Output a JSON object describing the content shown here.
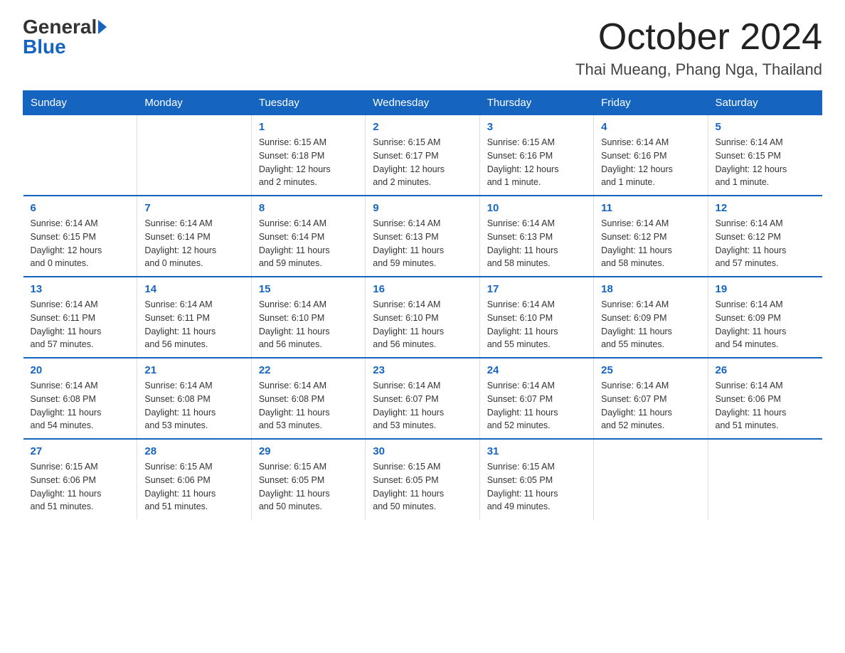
{
  "logo": {
    "general": "General",
    "blue": "Blue"
  },
  "header": {
    "month": "October 2024",
    "location": "Thai Mueang, Phang Nga, Thailand"
  },
  "weekdays": [
    "Sunday",
    "Monday",
    "Tuesday",
    "Wednesday",
    "Thursday",
    "Friday",
    "Saturday"
  ],
  "weeks": [
    [
      {
        "day": "",
        "info": ""
      },
      {
        "day": "",
        "info": ""
      },
      {
        "day": "1",
        "info": "Sunrise: 6:15 AM\nSunset: 6:18 PM\nDaylight: 12 hours\nand 2 minutes."
      },
      {
        "day": "2",
        "info": "Sunrise: 6:15 AM\nSunset: 6:17 PM\nDaylight: 12 hours\nand 2 minutes."
      },
      {
        "day": "3",
        "info": "Sunrise: 6:15 AM\nSunset: 6:16 PM\nDaylight: 12 hours\nand 1 minute."
      },
      {
        "day": "4",
        "info": "Sunrise: 6:14 AM\nSunset: 6:16 PM\nDaylight: 12 hours\nand 1 minute."
      },
      {
        "day": "5",
        "info": "Sunrise: 6:14 AM\nSunset: 6:15 PM\nDaylight: 12 hours\nand 1 minute."
      }
    ],
    [
      {
        "day": "6",
        "info": "Sunrise: 6:14 AM\nSunset: 6:15 PM\nDaylight: 12 hours\nand 0 minutes."
      },
      {
        "day": "7",
        "info": "Sunrise: 6:14 AM\nSunset: 6:14 PM\nDaylight: 12 hours\nand 0 minutes."
      },
      {
        "day": "8",
        "info": "Sunrise: 6:14 AM\nSunset: 6:14 PM\nDaylight: 11 hours\nand 59 minutes."
      },
      {
        "day": "9",
        "info": "Sunrise: 6:14 AM\nSunset: 6:13 PM\nDaylight: 11 hours\nand 59 minutes."
      },
      {
        "day": "10",
        "info": "Sunrise: 6:14 AM\nSunset: 6:13 PM\nDaylight: 11 hours\nand 58 minutes."
      },
      {
        "day": "11",
        "info": "Sunrise: 6:14 AM\nSunset: 6:12 PM\nDaylight: 11 hours\nand 58 minutes."
      },
      {
        "day": "12",
        "info": "Sunrise: 6:14 AM\nSunset: 6:12 PM\nDaylight: 11 hours\nand 57 minutes."
      }
    ],
    [
      {
        "day": "13",
        "info": "Sunrise: 6:14 AM\nSunset: 6:11 PM\nDaylight: 11 hours\nand 57 minutes."
      },
      {
        "day": "14",
        "info": "Sunrise: 6:14 AM\nSunset: 6:11 PM\nDaylight: 11 hours\nand 56 minutes."
      },
      {
        "day": "15",
        "info": "Sunrise: 6:14 AM\nSunset: 6:10 PM\nDaylight: 11 hours\nand 56 minutes."
      },
      {
        "day": "16",
        "info": "Sunrise: 6:14 AM\nSunset: 6:10 PM\nDaylight: 11 hours\nand 56 minutes."
      },
      {
        "day": "17",
        "info": "Sunrise: 6:14 AM\nSunset: 6:10 PM\nDaylight: 11 hours\nand 55 minutes."
      },
      {
        "day": "18",
        "info": "Sunrise: 6:14 AM\nSunset: 6:09 PM\nDaylight: 11 hours\nand 55 minutes."
      },
      {
        "day": "19",
        "info": "Sunrise: 6:14 AM\nSunset: 6:09 PM\nDaylight: 11 hours\nand 54 minutes."
      }
    ],
    [
      {
        "day": "20",
        "info": "Sunrise: 6:14 AM\nSunset: 6:08 PM\nDaylight: 11 hours\nand 54 minutes."
      },
      {
        "day": "21",
        "info": "Sunrise: 6:14 AM\nSunset: 6:08 PM\nDaylight: 11 hours\nand 53 minutes."
      },
      {
        "day": "22",
        "info": "Sunrise: 6:14 AM\nSunset: 6:08 PM\nDaylight: 11 hours\nand 53 minutes."
      },
      {
        "day": "23",
        "info": "Sunrise: 6:14 AM\nSunset: 6:07 PM\nDaylight: 11 hours\nand 53 minutes."
      },
      {
        "day": "24",
        "info": "Sunrise: 6:14 AM\nSunset: 6:07 PM\nDaylight: 11 hours\nand 52 minutes."
      },
      {
        "day": "25",
        "info": "Sunrise: 6:14 AM\nSunset: 6:07 PM\nDaylight: 11 hours\nand 52 minutes."
      },
      {
        "day": "26",
        "info": "Sunrise: 6:14 AM\nSunset: 6:06 PM\nDaylight: 11 hours\nand 51 minutes."
      }
    ],
    [
      {
        "day": "27",
        "info": "Sunrise: 6:15 AM\nSunset: 6:06 PM\nDaylight: 11 hours\nand 51 minutes."
      },
      {
        "day": "28",
        "info": "Sunrise: 6:15 AM\nSunset: 6:06 PM\nDaylight: 11 hours\nand 51 minutes."
      },
      {
        "day": "29",
        "info": "Sunrise: 6:15 AM\nSunset: 6:05 PM\nDaylight: 11 hours\nand 50 minutes."
      },
      {
        "day": "30",
        "info": "Sunrise: 6:15 AM\nSunset: 6:05 PM\nDaylight: 11 hours\nand 50 minutes."
      },
      {
        "day": "31",
        "info": "Sunrise: 6:15 AM\nSunset: 6:05 PM\nDaylight: 11 hours\nand 49 minutes."
      },
      {
        "day": "",
        "info": ""
      },
      {
        "day": "",
        "info": ""
      }
    ]
  ]
}
